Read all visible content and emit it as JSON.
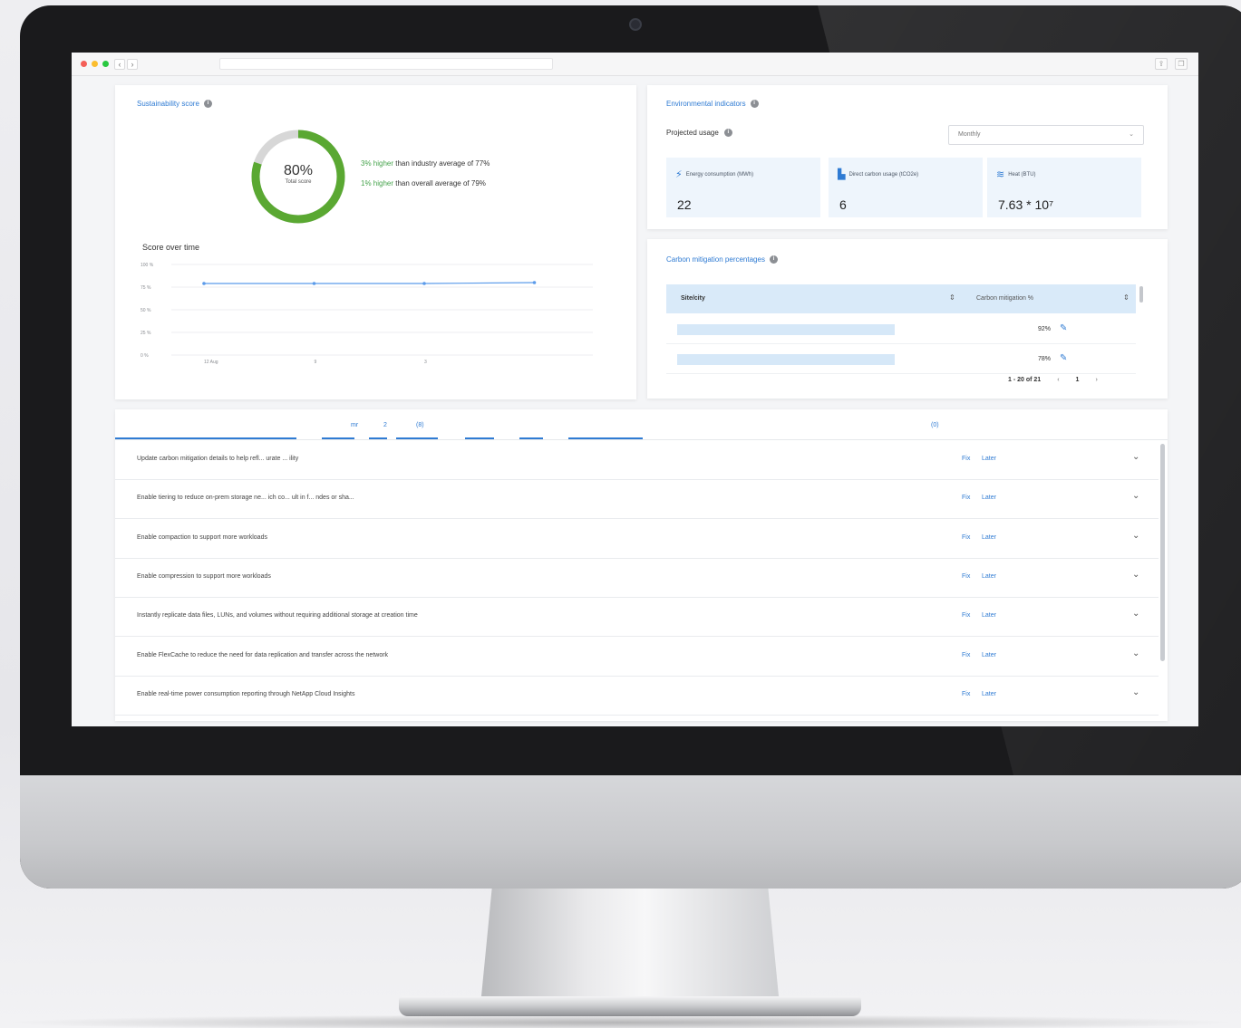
{
  "sustainability": {
    "title": "Sustainability score",
    "score_value": 80,
    "score_pct": "80%",
    "score_label": "Total score",
    "comparisons": [
      {
        "highlight": "3% higher",
        "rest": " than industry average of 77%"
      },
      {
        "highlight": "1% higher",
        "rest": " than overall average of 79%"
      }
    ],
    "over_time_title": "Score over time",
    "colors": {
      "ring": "#5aa832",
      "ring_track": "#d7d7d7",
      "line": "#5b9bea"
    }
  },
  "chart_data": {
    "type": "line",
    "title": "Score over time",
    "y_ticks": [
      "100 %",
      "75 %",
      "50 %",
      "25 %",
      "0 %"
    ],
    "x_ticks": [
      "12 Aug",
      "9",
      "3",
      ""
    ],
    "ylim": [
      0,
      100
    ],
    "series": [
      {
        "values": [
          79,
          79,
          79,
          80
        ]
      }
    ]
  },
  "env": {
    "title": "Environmental indicators",
    "projected_label": "Projected usage",
    "select_value": "Monthly",
    "tiles": [
      {
        "icon": "bolt-icon",
        "label": "Energy consumption (MWh)",
        "value": "22"
      },
      {
        "icon": "factory-icon",
        "label": "Direct carbon usage (tCO2e)",
        "value": "6"
      },
      {
        "icon": "heat-icon",
        "label": "Heat (BTU)",
        "value": "7.63 * 10⁷"
      }
    ]
  },
  "carbon": {
    "title": "Carbon mitigation percentages",
    "col_site": "Site/city",
    "col_pct": "Carbon mitigation %",
    "rows": [
      {
        "pct": "92%"
      },
      {
        "pct": "78%"
      }
    ],
    "pager_range": "1 - 20 of 21",
    "pager_page": "1",
    "pager_prev": "‹",
    "pager_next": "›"
  },
  "recommendations": {
    "tabs": [
      "mr",
      "2",
      "(8)",
      "(0)"
    ],
    "fix_label": "Fix",
    "later_label": "Later",
    "items": [
      "Update carbon mitigation details to help refl... urate ... ility",
      "Enable tiering to reduce on-prem storage ne... ich co... ult in f... ndes or sha...",
      "Enable compaction to support more workloads",
      "Enable compression to support more workloads",
      "Instantly replicate data files, LUNs, and volumes without requiring additional storage at creation time",
      "Enable FlexCache to reduce the need for data replication and transfer across the network",
      "Enable real-time power consumption reporting through NetApp Cloud Insights"
    ]
  }
}
